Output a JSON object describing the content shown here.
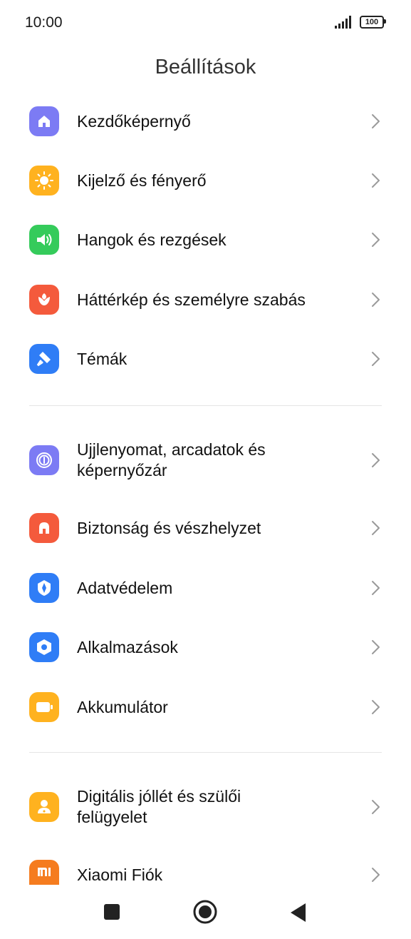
{
  "status": {
    "time": "10:00",
    "battery": "100"
  },
  "page": {
    "title": "Beállítások"
  },
  "sections": [
    [
      {
        "label": "Kezdőképernyő",
        "icon": "home-icon",
        "color": "#7C7BF4"
      },
      {
        "label": "Kijelző és fényerő",
        "icon": "sun-icon",
        "color": "#FFB21F"
      },
      {
        "label": "Hangok és rezgések",
        "icon": "speaker-icon",
        "color": "#35CB5B"
      },
      {
        "label": "Háttérkép és személyre szabás",
        "icon": "flower-icon",
        "color": "#F45A3C"
      },
      {
        "label": "Témák",
        "icon": "brush-icon",
        "color": "#2F7DF6"
      }
    ],
    [
      {
        "label": "Ujjlenyomat, arcadatok és képernyőzár",
        "icon": "fingerprint-icon",
        "color": "#7C7BF4"
      },
      {
        "label": "Biztonság és vészhelyzet",
        "icon": "shield-icon",
        "color": "#F45A3C"
      },
      {
        "label": "Adatvédelem",
        "icon": "privacy-icon",
        "color": "#2F7DF6"
      },
      {
        "label": "Alkalmazások",
        "icon": "hexagon-icon",
        "color": "#2F7DF6"
      },
      {
        "label": "Akkumulátor",
        "icon": "battery-icon",
        "color": "#FFB21F"
      }
    ],
    [
      {
        "label": "Digitális jóllét és szülői felügyelet",
        "icon": "wellbeing-icon",
        "color": "#FFB21F"
      },
      {
        "label": "Xiaomi Fiók",
        "icon": "mi-icon",
        "color": "#F57C1F"
      }
    ]
  ]
}
